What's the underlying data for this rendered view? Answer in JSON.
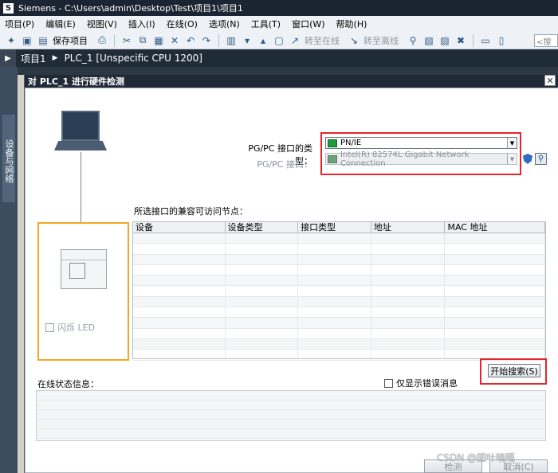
{
  "window": {
    "title": "Siemens  -  C:\\Users\\admin\\Desktop\\Test\\项目1\\项目1"
  },
  "menu": [
    "项目(P)",
    "编辑(E)",
    "视图(V)",
    "插入(I)",
    "在线(O)",
    "选项(N)",
    "工具(T)",
    "窗口(W)",
    "帮助(H)"
  ],
  "toolbar": {
    "save_label": "保存项目",
    "go_online": "转至在线",
    "go_offline": "转至离线",
    "search_placeholder": "<搜"
  },
  "project": {
    "crumb1": "项目1",
    "crumb2": "PLC_1 [Unspecific CPU 1200]"
  },
  "sidebar": {
    "label": "设备与网络"
  },
  "dialog": {
    "title": "对 PLC_1 进行硬件检测",
    "close_glyph": "✕",
    "iface_type_label": "PG/PC 接口的类型：",
    "iface_type_value": "PN/IE",
    "iface_label": "PG/PC 接口：",
    "iface_value": "Intel(R) 82574L Gigabit Network Connection",
    "nodes_label": "所选接口的兼容可访问节点：",
    "columns": [
      "设备",
      "设备类型",
      "接口类型",
      "地址",
      "MAC 地址"
    ],
    "flash_led": "闪烁 LED",
    "start_search": "开始搜索(S)",
    "status_label": "在线状态信息：",
    "errors_only": "仅显示错误消息",
    "detect_button": "检测",
    "cancel_button": "取消(C)"
  },
  "watermark": "CSDN @园叶晓晤",
  "colors": {
    "highlight_red": "#e8232a",
    "highlight_orange": "#f5a623",
    "title_dark": "#1f2a36"
  }
}
